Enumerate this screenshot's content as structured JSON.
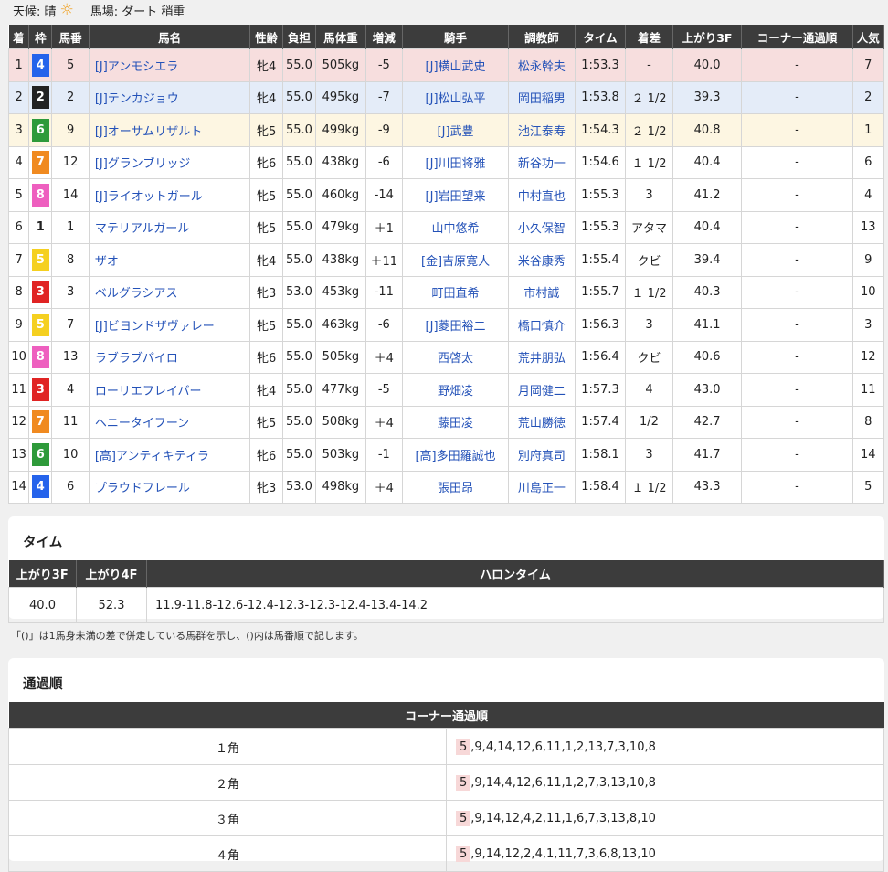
{
  "weather": {
    "label": "天候: 晴",
    "icon": "sun-icon",
    "track": "馬場: ダート 稍重"
  },
  "columns": [
    "着",
    "枠",
    "馬番",
    "馬名",
    "性齢",
    "負担",
    "馬体重",
    "増減",
    "騎手",
    "調教師",
    "タイム",
    "着差",
    "上がり3F",
    "コーナー通過順",
    "人気"
  ],
  "waku_colors": {
    "1": {
      "bg": "#ffffff",
      "fg": "#222222"
    },
    "2": {
      "bg": "#222222",
      "fg": "#ffffff"
    },
    "3": {
      "bg": "#e02424",
      "fg": "#ffffff"
    },
    "4": {
      "bg": "#2563eb",
      "fg": "#ffffff"
    },
    "5": {
      "bg": "#f5d020",
      "fg": "#ffffff"
    },
    "6": {
      "bg": "#2e9a3a",
      "fg": "#ffffff"
    },
    "7": {
      "bg": "#f08a20",
      "fg": "#ffffff"
    },
    "8": {
      "bg": "#ee5fbf",
      "fg": "#ffffff"
    }
  },
  "rows": [
    {
      "rank": "1",
      "waku": "4",
      "num": "5",
      "name": "[J]アンモシエラ",
      "sexage": "牝4",
      "weight": "55.0",
      "body": "505kg",
      "diff": "-5",
      "jockey": "[J]横山武史",
      "trainer": "松永幹夫",
      "time": "1:53.3",
      "margin": "-",
      "last3f": "40.0",
      "corner": "-",
      "pop": "7"
    },
    {
      "rank": "2",
      "waku": "2",
      "num": "2",
      "name": "[J]テンカジョウ",
      "sexage": "牝4",
      "weight": "55.0",
      "body": "495kg",
      "diff": "-7",
      "jockey": "[J]松山弘平",
      "trainer": "岡田稲男",
      "time": "1:53.8",
      "margin": "２ 1/2",
      "last3f": "39.3",
      "corner": "-",
      "pop": "2"
    },
    {
      "rank": "3",
      "waku": "6",
      "num": "9",
      "name": "[J]オーサムリザルト",
      "sexage": "牝5",
      "weight": "55.0",
      "body": "499kg",
      "diff": "-9",
      "jockey": "[J]武豊",
      "trainer": "池江泰寿",
      "time": "1:54.3",
      "margin": "２ 1/2",
      "last3f": "40.8",
      "corner": "-",
      "pop": "1"
    },
    {
      "rank": "4",
      "waku": "7",
      "num": "12",
      "name": "[J]グランブリッジ",
      "sexage": "牝6",
      "weight": "55.0",
      "body": "438kg",
      "diff": "-6",
      "jockey": "[J]川田将雅",
      "trainer": "新谷功一",
      "time": "1:54.6",
      "margin": "１ 1/2",
      "last3f": "40.4",
      "corner": "-",
      "pop": "6"
    },
    {
      "rank": "5",
      "waku": "8",
      "num": "14",
      "name": "[J]ライオットガール",
      "sexage": "牝5",
      "weight": "55.0",
      "body": "460kg",
      "diff": "-14",
      "jockey": "[J]岩田望来",
      "trainer": "中村直也",
      "time": "1:55.3",
      "margin": "3",
      "last3f": "41.2",
      "corner": "-",
      "pop": "4"
    },
    {
      "rank": "6",
      "waku": "1",
      "num": "1",
      "name": "マテリアルガール",
      "sexage": "牝5",
      "weight": "55.0",
      "body": "479kg",
      "diff": "＋1",
      "jockey": "山中悠希",
      "trainer": "小久保智",
      "time": "1:55.3",
      "margin": "アタマ",
      "last3f": "40.4",
      "corner": "-",
      "pop": "13"
    },
    {
      "rank": "7",
      "waku": "5",
      "num": "8",
      "name": "ザオ",
      "sexage": "牝4",
      "weight": "55.0",
      "body": "438kg",
      "diff": "＋11",
      "jockey": "[金]吉原寛人",
      "trainer": "米谷康秀",
      "time": "1:55.4",
      "margin": "クビ",
      "last3f": "39.4",
      "corner": "-",
      "pop": "9"
    },
    {
      "rank": "8",
      "waku": "3",
      "num": "3",
      "name": "ベルグラシアス",
      "sexage": "牝3",
      "weight": "53.0",
      "body": "453kg",
      "diff": "-11",
      "jockey": "町田直希",
      "trainer": "市村誠",
      "time": "1:55.7",
      "margin": "１ 1/2",
      "last3f": "40.3",
      "corner": "-",
      "pop": "10"
    },
    {
      "rank": "9",
      "waku": "5",
      "num": "7",
      "name": "[J]ビヨンドザヴァレー",
      "sexage": "牝5",
      "weight": "55.0",
      "body": "463kg",
      "diff": "-6",
      "jockey": "[J]菱田裕二",
      "trainer": "橋口慎介",
      "time": "1:56.3",
      "margin": "3",
      "last3f": "41.1",
      "corner": "-",
      "pop": "3"
    },
    {
      "rank": "10",
      "waku": "8",
      "num": "13",
      "name": "ラブラブパイロ",
      "sexage": "牝6",
      "weight": "55.0",
      "body": "505kg",
      "diff": "＋4",
      "jockey": "西啓太",
      "trainer": "荒井朋弘",
      "time": "1:56.4",
      "margin": "クビ",
      "last3f": "40.6",
      "corner": "-",
      "pop": "12"
    },
    {
      "rank": "11",
      "waku": "3",
      "num": "4",
      "name": "ローリエフレイバー",
      "sexage": "牝4",
      "weight": "55.0",
      "body": "477kg",
      "diff": "-5",
      "jockey": "野畑凌",
      "trainer": "月岡健二",
      "time": "1:57.3",
      "margin": "4",
      "last3f": "43.0",
      "corner": "-",
      "pop": "11"
    },
    {
      "rank": "12",
      "waku": "7",
      "num": "11",
      "name": "ヘニータイフーン",
      "sexage": "牝5",
      "weight": "55.0",
      "body": "508kg",
      "diff": "＋4",
      "jockey": "藤田凌",
      "trainer": "荒山勝徳",
      "time": "1:57.4",
      "margin": "1/2",
      "last3f": "42.7",
      "corner": "-",
      "pop": "8"
    },
    {
      "rank": "13",
      "waku": "6",
      "num": "10",
      "name": "[高]アンティキティラ",
      "sexage": "牝6",
      "weight": "55.0",
      "body": "503kg",
      "diff": "-1",
      "jockey": "[高]多田羅誠也",
      "trainer": "別府真司",
      "time": "1:58.1",
      "margin": "3",
      "last3f": "41.7",
      "corner": "-",
      "pop": "14"
    },
    {
      "rank": "14",
      "waku": "4",
      "num": "6",
      "name": "プラウドフレール",
      "sexage": "牝3",
      "weight": "53.0",
      "body": "498kg",
      "diff": "＋4",
      "jockey": "張田昂",
      "trainer": "川島正一",
      "time": "1:58.4",
      "margin": "１ 1/2",
      "last3f": "43.3",
      "corner": "-",
      "pop": "5"
    }
  ],
  "time_section": {
    "title": "タイム",
    "headers": [
      "上がり3F",
      "上がり4F",
      "ハロンタイム"
    ],
    "last3f": "40.0",
    "last4f": "52.3",
    "halon": "11.9-11.8-12.6-12.4-12.3-12.3-12.4-13.4-14.2"
  },
  "note": "「()」は1馬身未満の差で併走している馬群を示し、()内は馬番順で記します。",
  "passing": {
    "title": "通過順",
    "header": "コーナー通過順",
    "rows": [
      {
        "corner": "１角",
        "lead": "5",
        "rest": ",9,4,14,12,6,11,1,2,13,7,3,10,8"
      },
      {
        "corner": "２角",
        "lead": "5",
        "rest": ",9,14,4,12,6,11,1,2,7,3,13,10,8"
      },
      {
        "corner": "３角",
        "lead": "5",
        "rest": ",9,14,12,4,2,11,1,6,7,3,13,8,10"
      },
      {
        "corner": "４角",
        "lead": "5",
        "rest": ",9,14,12,2,4,1,11,7,3,6,8,13,10"
      }
    ]
  }
}
